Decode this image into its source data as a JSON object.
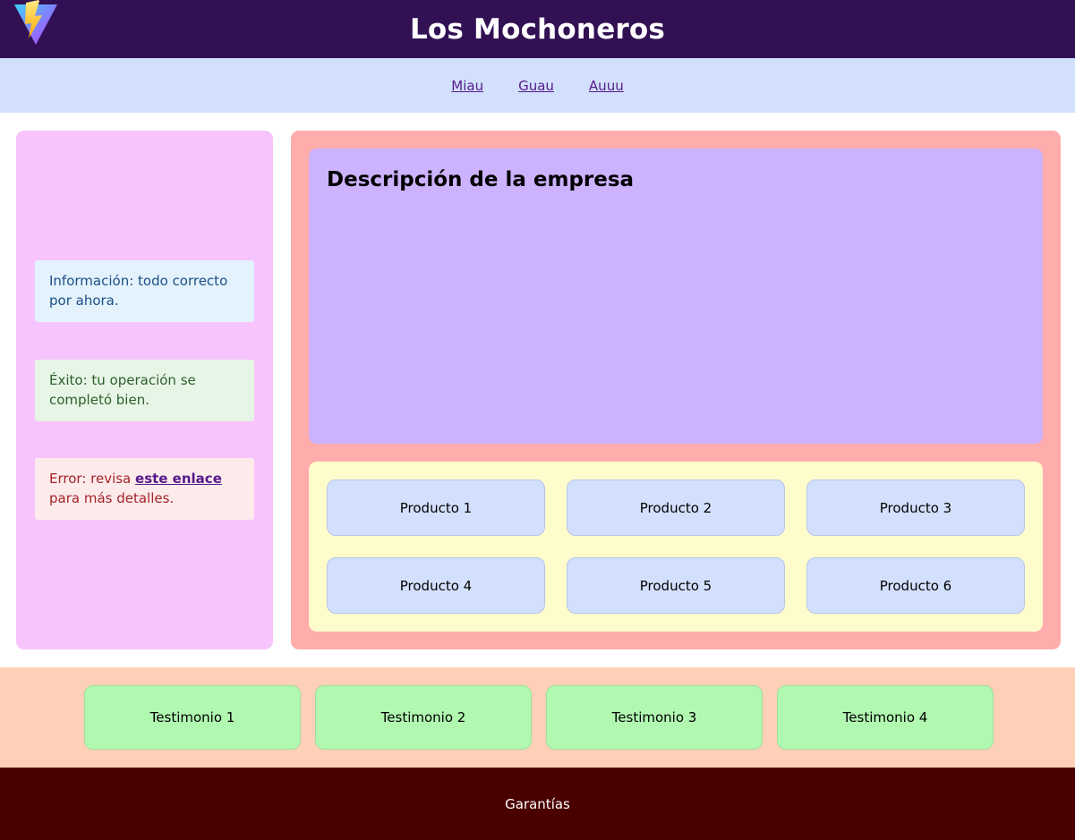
{
  "header": {
    "title": "Los Mochoneros",
    "logo_icon": "vite-logo-icon"
  },
  "nav": {
    "items": [
      {
        "label": "Miau"
      },
      {
        "label": "Guau"
      },
      {
        "label": "Auuu"
      }
    ]
  },
  "sidebar": {
    "info": {
      "text": "Información: todo correcto por ahora."
    },
    "success": {
      "text": "Éxito: tu operación se completó bien."
    },
    "error": {
      "prefix": "Error: revisa ",
      "link": "este enlace",
      "suffix": " para más detalles."
    }
  },
  "main": {
    "description_title": "Descripción de la empresa",
    "products": [
      {
        "label": "Producto 1"
      },
      {
        "label": "Producto 2"
      },
      {
        "label": "Producto 3"
      },
      {
        "label": "Producto 4"
      },
      {
        "label": "Producto 5"
      },
      {
        "label": "Producto 6"
      }
    ]
  },
  "testimonials": [
    {
      "label": "Testimonio 1"
    },
    {
      "label": "Testimonio 2"
    },
    {
      "label": "Testimonio 3"
    },
    {
      "label": "Testimonio 4"
    }
  ],
  "footer": {
    "text": "Garantías"
  },
  "colors": {
    "header_bg": "#311153",
    "nav_bg": "#d3e0fd",
    "sidebar_bg": "#f8c4fd",
    "main_bg": "#ffadac",
    "description_bg": "#cdb3fe",
    "products_bg": "#fffccc",
    "testimonials_bg": "#fed0b7",
    "testimonial_bg": "#b1f8b1",
    "footer_bg": "#4b0000"
  }
}
